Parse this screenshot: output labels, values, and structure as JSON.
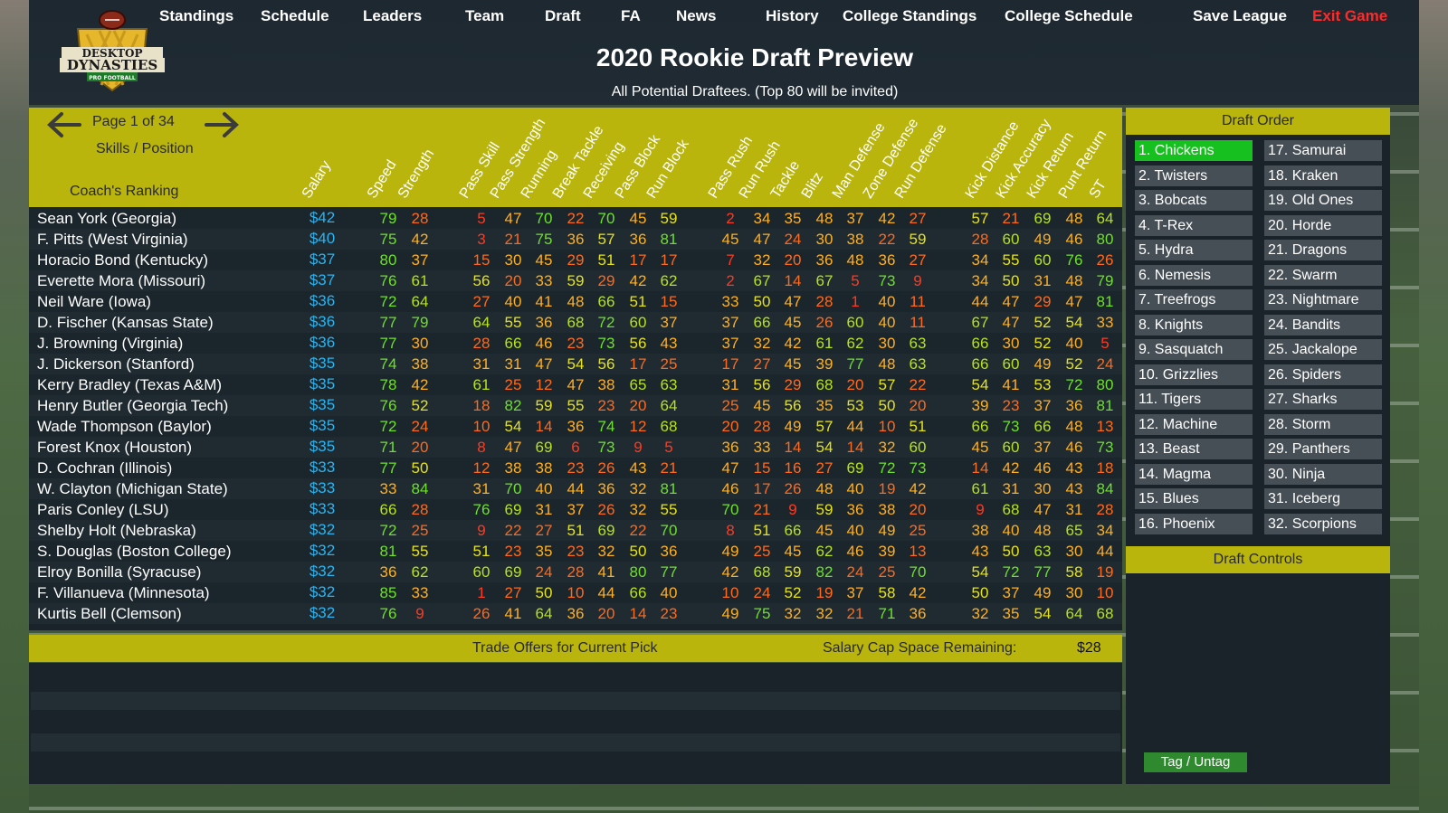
{
  "nav": {
    "items": [
      "Standings",
      "Schedule",
      "Leaders",
      "Team",
      "Draft",
      "FA",
      "News",
      "History",
      "College Standings",
      "College Schedule",
      "Save League"
    ],
    "exit_label": "Exit Game",
    "logo": {
      "line1": "DESKTOP",
      "line2": "DYNASTIES",
      "line3": "PRO FOOTBALL"
    }
  },
  "page": {
    "title": "2020 Rookie Draft Preview",
    "subtitle": "All Potential Draftees.  (Top 80 will be invited)"
  },
  "table": {
    "page_label": "Page 1 of 34",
    "skills_label": "Skills / Position",
    "coach_label": "Coach's Ranking",
    "columns": [
      "Salary",
      "Speed",
      "Strength",
      "Pass Skill",
      "Pass Strength",
      "Running",
      "Break Tackle",
      "Receiving",
      "Pass Block",
      "Run Block",
      "Pass Rush",
      "Run Rush",
      "Tackle",
      "Blitz",
      "Man Defense",
      "Zone Defense",
      "Run Defense",
      "Kick Distance",
      "Kick Accuracy",
      "Kick Return",
      "Punt Return",
      "ST"
    ],
    "rows": [
      {
        "name": "Sean York  (Georgia)",
        "salary": "$42",
        "vals": [
          79,
          28,
          5,
          47,
          70,
          22,
          70,
          45,
          59,
          2,
          34,
          35,
          48,
          37,
          42,
          27,
          57,
          21,
          69,
          48,
          64
        ]
      },
      {
        "name": "F. Pitts  (West Virginia)",
        "salary": "$40",
        "vals": [
          75,
          42,
          3,
          21,
          75,
          36,
          57,
          36,
          81,
          45,
          47,
          24,
          30,
          38,
          22,
          59,
          28,
          60,
          49,
          46,
          80
        ]
      },
      {
        "name": "Horacio Bond  (Kentucky)",
        "salary": "$37",
        "vals": [
          80,
          37,
          15,
          30,
          45,
          29,
          51,
          17,
          17,
          7,
          32,
          20,
          36,
          48,
          36,
          27,
          34,
          55,
          60,
          76,
          26
        ]
      },
      {
        "name": "Everette Mora  (Missouri)",
        "salary": "$37",
        "vals": [
          76,
          61,
          56,
          20,
          33,
          59,
          29,
          42,
          62,
          2,
          67,
          14,
          67,
          5,
          73,
          9,
          34,
          50,
          31,
          48,
          79
        ]
      },
      {
        "name": "Neil Ware  (Iowa)",
        "salary": "$36",
        "vals": [
          72,
          64,
          27,
          40,
          41,
          48,
          66,
          51,
          15,
          33,
          50,
          47,
          28,
          1,
          40,
          11,
          44,
          47,
          29,
          47,
          81
        ]
      },
      {
        "name": "D. Fischer  (Kansas State)",
        "salary": "$36",
        "vals": [
          77,
          79,
          64,
          55,
          36,
          68,
          72,
          60,
          37,
          37,
          66,
          45,
          26,
          60,
          40,
          11,
          67,
          47,
          52,
          54,
          33
        ]
      },
      {
        "name": "J. Browning  (Virginia)",
        "salary": "$36",
        "vals": [
          77,
          30,
          28,
          66,
          46,
          23,
          73,
          56,
          43,
          37,
          32,
          42,
          61,
          62,
          30,
          63,
          66,
          30,
          52,
          40,
          5
        ]
      },
      {
        "name": "J. Dickerson  (Stanford)",
        "salary": "$35",
        "vals": [
          74,
          38,
          31,
          31,
          47,
          54,
          56,
          17,
          25,
          17,
          27,
          45,
          39,
          77,
          48,
          63,
          66,
          60,
          49,
          52,
          24
        ]
      },
      {
        "name": "Kerry Bradley  (Texas A&M)",
        "salary": "$35",
        "vals": [
          78,
          42,
          61,
          25,
          12,
          47,
          38,
          65,
          63,
          31,
          56,
          29,
          68,
          20,
          57,
          22,
          54,
          41,
          53,
          72,
          80
        ]
      },
      {
        "name": "Henry Butler  (Georgia Tech)",
        "salary": "$35",
        "vals": [
          76,
          52,
          18,
          82,
          59,
          55,
          23,
          20,
          64,
          25,
          45,
          56,
          35,
          53,
          50,
          20,
          39,
          23,
          37,
          36,
          81
        ]
      },
      {
        "name": "Wade Thompson  (Baylor)",
        "salary": "$35",
        "vals": [
          72,
          24,
          10,
          54,
          14,
          36,
          74,
          12,
          68,
          20,
          28,
          49,
          57,
          44,
          10,
          51,
          66,
          73,
          66,
          48,
          13
        ]
      },
      {
        "name": "Forest Knox  (Houston)",
        "salary": "$35",
        "vals": [
          71,
          20,
          8,
          47,
          69,
          6,
          73,
          9,
          5,
          36,
          33,
          14,
          54,
          14,
          32,
          60,
          45,
          60,
          37,
          46,
          73
        ]
      },
      {
        "name": "D. Cochran  (Illinois)",
        "salary": "$33",
        "vals": [
          77,
          50,
          12,
          38,
          38,
          23,
          26,
          43,
          21,
          47,
          15,
          16,
          27,
          69,
          72,
          73,
          14,
          42,
          46,
          43,
          18
        ]
      },
      {
        "name": "W. Clayton  (Michigan State)",
        "salary": "$33",
        "vals": [
          33,
          84,
          31,
          70,
          40,
          44,
          36,
          32,
          81,
          46,
          17,
          26,
          48,
          40,
          19,
          42,
          61,
          31,
          30,
          43,
          84
        ]
      },
      {
        "name": "Paris Conley  (LSU)",
        "salary": "$33",
        "vals": [
          66,
          28,
          76,
          69,
          31,
          37,
          26,
          32,
          55,
          70,
          21,
          9,
          59,
          36,
          38,
          20,
          9,
          68,
          47,
          31,
          28
        ]
      },
      {
        "name": "Shelby Holt  (Nebraska)",
        "salary": "$32",
        "vals": [
          72,
          25,
          9,
          22,
          27,
          51,
          69,
          22,
          70,
          8,
          51,
          66,
          45,
          40,
          49,
          25,
          38,
          40,
          48,
          65,
          34
        ]
      },
      {
        "name": "S. Douglas  (Boston College)",
        "salary": "$32",
        "vals": [
          81,
          55,
          51,
          23,
          35,
          23,
          32,
          50,
          36,
          49,
          25,
          45,
          62,
          46,
          39,
          13,
          43,
          50,
          63,
          30,
          44
        ]
      },
      {
        "name": "Elroy Bonilla  (Syracuse)",
        "salary": "$32",
        "vals": [
          36,
          62,
          60,
          69,
          24,
          28,
          41,
          80,
          77,
          42,
          68,
          59,
          82,
          24,
          25,
          70,
          54,
          72,
          77,
          58,
          19
        ]
      },
      {
        "name": "F. Villanueva  (Minnesota)",
        "salary": "$32",
        "vals": [
          85,
          33,
          1,
          27,
          50,
          10,
          44,
          66,
          40,
          10,
          24,
          52,
          19,
          37,
          58,
          42,
          50,
          37,
          49,
          30,
          10
        ]
      },
      {
        "name": "Kurtis Bell  (Clemson)",
        "salary": "$32",
        "vals": [
          76,
          9,
          26,
          41,
          64,
          36,
          20,
          14,
          23,
          49,
          75,
          32,
          32,
          21,
          71,
          36,
          32,
          35,
          54,
          64,
          68
        ]
      }
    ]
  },
  "trade": {
    "label": "Trade Offers for Current Pick",
    "cap_label": "Salary Cap Space Remaining:",
    "cap_value": "$28"
  },
  "draft_order": {
    "title": "Draft Order",
    "teams": [
      "1. Chickens",
      "2. Twisters",
      "3. Bobcats",
      "4. T-Rex",
      "5. Hydra",
      "6. Nemesis",
      "7. Treefrogs",
      "8. Knights",
      "9. Sasquatch",
      "10. Grizzlies",
      "11. Tigers",
      "12. Machine",
      "13. Beast",
      "14. Magma",
      "15. Blues",
      "16. Phoenix",
      "17. Samurai",
      "18. Kraken",
      "19. Old Ones",
      "20. Horde",
      "21. Dragons",
      "22. Swarm",
      "23. Nightmare",
      "24. Bandits",
      "25. Jackalope",
      "26. Spiders",
      "27. Sharks",
      "28. Storm",
      "29. Panthers",
      "30. Ninja",
      "31. Iceberg",
      "32. Scorpions"
    ]
  },
  "draft_controls": {
    "title": "Draft Controls",
    "tag_label": "Tag / Untag"
  },
  "colors": {
    "accent": "#b9b50d",
    "active_team": "#16c11f",
    "salary": "#2bb4f0",
    "exit": "#ff2a2a"
  }
}
